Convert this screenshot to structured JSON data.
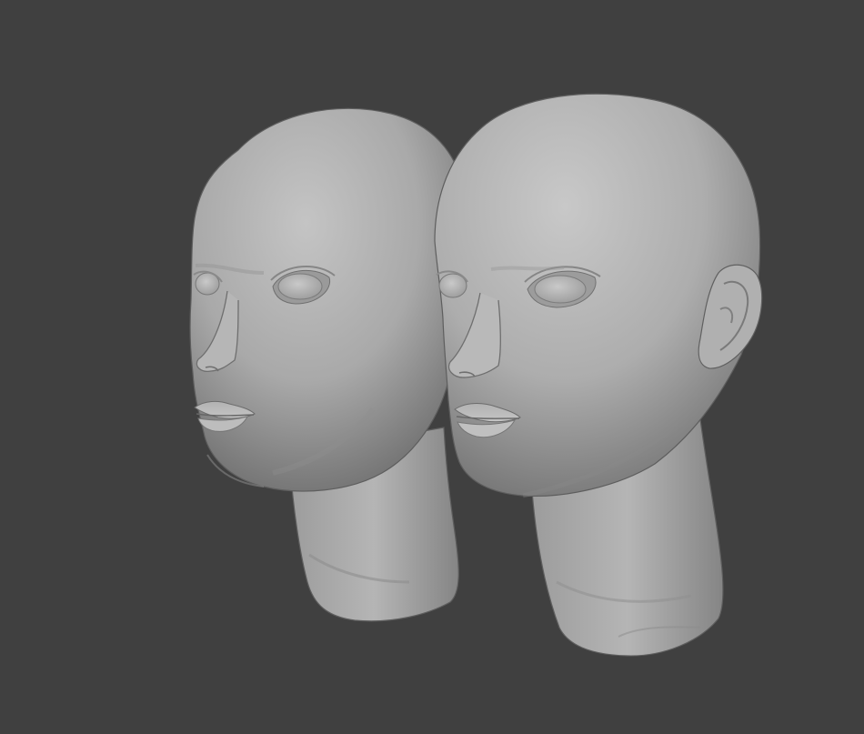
{
  "viewport": {
    "background": "#404040",
    "objects": [
      {
        "name": "head-sculpt-left",
        "color": "#a9a9a9"
      },
      {
        "name": "head-sculpt-right",
        "color": "#adadad"
      }
    ]
  }
}
